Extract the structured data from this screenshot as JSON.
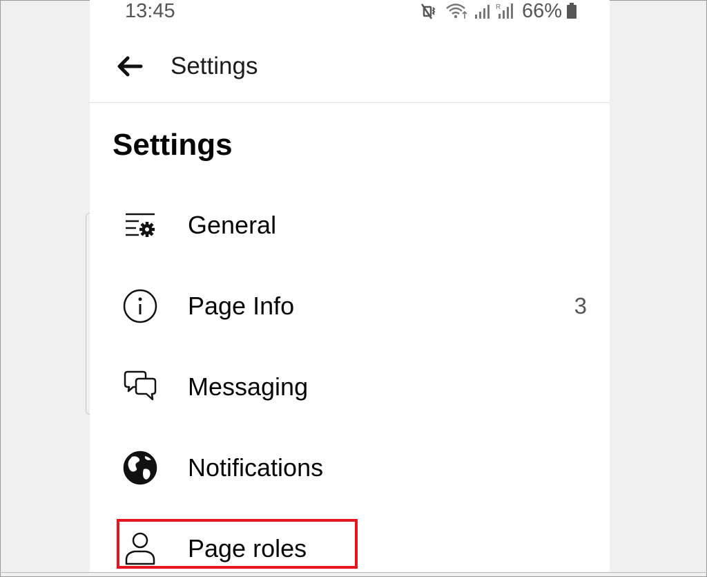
{
  "status_bar": {
    "time": "13:45",
    "battery": "66%",
    "icons": [
      "mute-vibrate-icon",
      "wifi-icon",
      "signal-icon",
      "roaming-signal-icon",
      "battery-icon"
    ]
  },
  "header": {
    "title": "Settings",
    "back_icon": "back-arrow-icon"
  },
  "section": {
    "title": "Settings"
  },
  "menu": {
    "items": [
      {
        "label": "General",
        "icon": "list-settings-icon",
        "count": ""
      },
      {
        "label": "Page Info",
        "icon": "info-icon",
        "count": "3"
      },
      {
        "label": "Messaging",
        "icon": "chat-bubbles-icon",
        "count": ""
      },
      {
        "label": "Notifications",
        "icon": "globe-icon",
        "count": ""
      },
      {
        "label": "Page roles",
        "icon": "person-icon",
        "count": ""
      }
    ]
  },
  "colors": {
    "highlight": "#e8141b",
    "text": "#050505",
    "muted": "#555555"
  }
}
